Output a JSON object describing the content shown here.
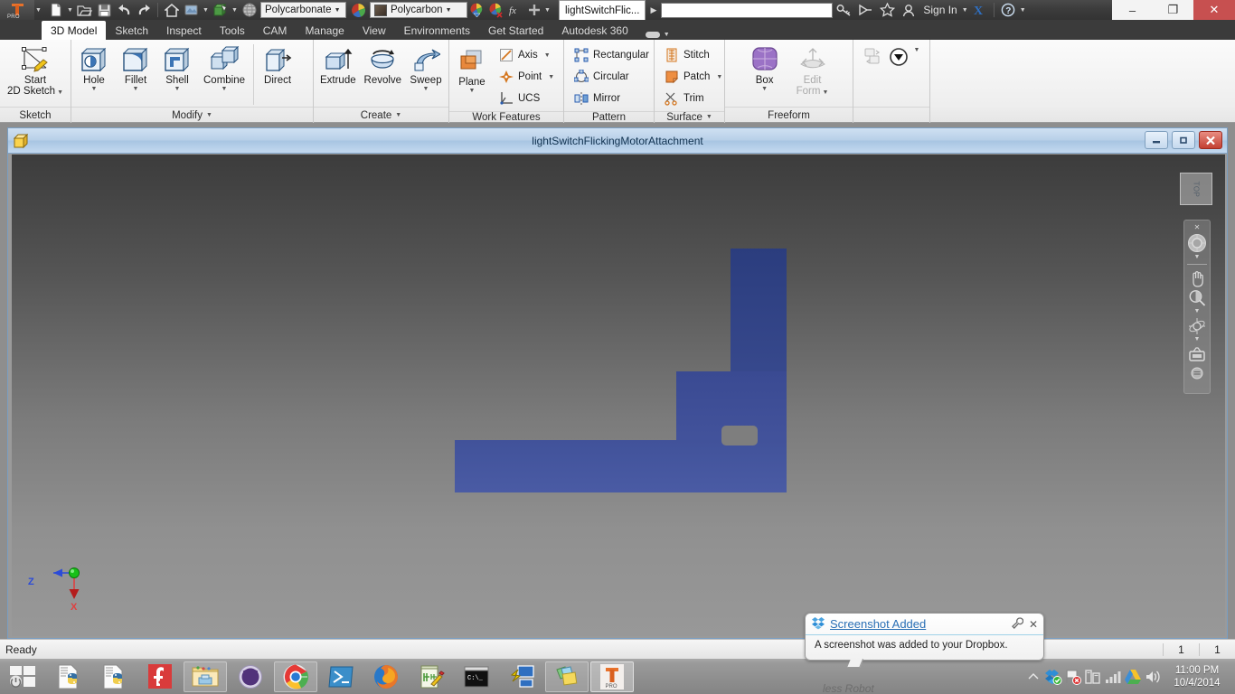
{
  "titlebar": {
    "app_logo": "inventor-logo",
    "app_logo_text": "PRO",
    "quick_access": [
      {
        "name": "new-document",
        "icon": "new-file-icon"
      },
      {
        "name": "open-document",
        "icon": "open-folder-icon"
      },
      {
        "name": "save-document",
        "icon": "save-disk-icon"
      },
      {
        "name": "undo",
        "icon": "undo-arrow-icon"
      },
      {
        "name": "redo",
        "icon": "redo-arrow-icon"
      },
      {
        "name": "home-view",
        "icon": "home-icon"
      },
      {
        "name": "appearance",
        "icon": "appearance-icon"
      },
      {
        "name": "material-swatch",
        "icon": "material-box-icon"
      },
      {
        "name": "render-globe",
        "icon": "globe-icon"
      }
    ],
    "material_combo": "Polycarbonate",
    "appearance_combo": "Polycarbon",
    "function_icon": "fx-icon",
    "document_tab": "lightSwitchFlic...",
    "search_placeholder": "",
    "search_value": "",
    "search_icon": "key-icon",
    "help_icons": [
      "satellite-icon",
      "star-icon"
    ],
    "sign_in": "Sign In",
    "exchange_icon": "X-exchange-icon",
    "help_icon": "question-help-icon",
    "window_controls": {
      "minimize": "–",
      "restore": "❐",
      "close": "✕"
    }
  },
  "ribbon_tabs": [
    {
      "label": "3D Model",
      "active": true
    },
    {
      "label": "Sketch",
      "active": false
    },
    {
      "label": "Inspect",
      "active": false
    },
    {
      "label": "Tools",
      "active": false
    },
    {
      "label": "CAM",
      "active": false
    },
    {
      "label": "Manage",
      "active": false
    },
    {
      "label": "View",
      "active": false
    },
    {
      "label": "Environments",
      "active": false
    },
    {
      "label": "Get Started",
      "active": false
    },
    {
      "label": "Autodesk 360",
      "active": false
    }
  ],
  "ribbon_panels": [
    {
      "title": "Sketch",
      "has_title_caret": false,
      "buttons": [
        {
          "label": "Start\n2D Sketch",
          "icon": "sketch-pencil-icon",
          "caret": true,
          "disabled": false
        }
      ]
    },
    {
      "title": "Modify",
      "has_title_caret": true,
      "buttons": [
        {
          "label": "Hole",
          "icon": "hole-cube-icon",
          "caret": true,
          "disabled": false
        },
        {
          "label": "Fillet",
          "icon": "fillet-cube-icon",
          "caret": true,
          "disabled": false
        },
        {
          "label": "Shell",
          "icon": "shell-cube-icon",
          "caret": true,
          "disabled": false
        },
        {
          "label": "Combine",
          "icon": "combine-cubes-icon",
          "caret": true,
          "disabled": false
        },
        {
          "label": "Direct",
          "icon": "direct-edit-icon",
          "caret": false,
          "disabled": false
        }
      ]
    },
    {
      "title": "Create",
      "has_title_caret": true,
      "buttons": [
        {
          "label": "Extrude",
          "icon": "extrude-icon",
          "caret": false,
          "disabled": false
        },
        {
          "label": "Revolve",
          "icon": "revolve-icon",
          "caret": false,
          "disabled": false
        },
        {
          "label": "Sweep",
          "icon": "sweep-icon",
          "caret": true,
          "disabled": false
        }
      ]
    },
    {
      "title": "Work Features",
      "has_title_caret": false,
      "buttons": [
        {
          "label": "Plane",
          "icon": "work-plane-icon",
          "caret": true,
          "disabled": false
        }
      ],
      "small_buttons": [
        {
          "label": "Axis",
          "icon": "work-axis-icon",
          "caret": true
        },
        {
          "label": "Point",
          "icon": "work-point-icon",
          "caret": true
        },
        {
          "label": "UCS",
          "icon": "ucs-icon",
          "caret": false
        }
      ]
    },
    {
      "title": "Pattern",
      "has_title_caret": false,
      "small_buttons": [
        {
          "label": "Rectangular",
          "icon": "rectangular-pattern-icon",
          "caret": false
        },
        {
          "label": "Circular",
          "icon": "circular-pattern-icon",
          "caret": false
        },
        {
          "label": "Mirror",
          "icon": "mirror-icon",
          "caret": false
        }
      ]
    },
    {
      "title": "Surface",
      "has_title_caret": true,
      "small_buttons": [
        {
          "label": "Stitch",
          "icon": "stitch-icon",
          "caret": false
        },
        {
          "label": "Patch",
          "icon": "patch-icon",
          "caret": true
        },
        {
          "label": "Trim",
          "icon": "trim-scissors-icon",
          "caret": false
        }
      ]
    },
    {
      "title": "Freeform",
      "has_title_caret": false,
      "buttons": [
        {
          "label": "Box",
          "icon": "freeform-box-icon",
          "caret": true,
          "disabled": false
        },
        {
          "label": "Edit\nForm",
          "icon": "edit-form-icon",
          "caret": true,
          "disabled": true
        }
      ]
    },
    {
      "title": "",
      "has_title_caret": false,
      "buttons": [
        {
          "label": "",
          "icon": "convert-icon",
          "caret": false,
          "disabled": true
        },
        {
          "label": "",
          "icon": "plastic-part-icon",
          "caret": true,
          "disabled": false
        }
      ]
    }
  ],
  "document_window": {
    "icon": "yellow-cube-icon",
    "title": "lightSwitchFlickingMotorAttachment",
    "controls": {
      "minimize": "—",
      "restore": "□",
      "close": "✕"
    }
  },
  "viewport": {
    "view_cube_label": "TOP",
    "nav_bar": [
      {
        "name": "steering-wheel-icon"
      },
      {
        "name": "pan-hand-icon"
      },
      {
        "name": "zoom-magnifier-icon"
      },
      {
        "name": "orbit-icon"
      },
      {
        "name": "look-at-camera-icon"
      }
    ],
    "nav_close_icon": "close-icon",
    "axis_indicator": {
      "z_label": "Z",
      "x_label": "X"
    },
    "model": {
      "name": "l-bracket-part",
      "body_color": "#41529a",
      "vertical_arm_color": "#2b3d7e",
      "slot_color": "#7e7e7e"
    }
  },
  "notification": {
    "icon": "dropbox-icon",
    "title": "Screenshot Added",
    "body": "A screenshot was added to your Dropbox.",
    "settings_icon": "wrench-icon",
    "close_icon": "close-x-icon"
  },
  "statusbar": {
    "message": "Ready",
    "cells": [
      "1",
      "1"
    ]
  },
  "taskbar": {
    "start_icon": "windows-start-icon",
    "items": [
      {
        "name": "python-file-1",
        "icon": "python-file-icon",
        "state": "normal"
      },
      {
        "name": "python-file-2",
        "icon": "python-file-icon",
        "state": "normal"
      },
      {
        "name": "fritzing",
        "icon": "fritzing-f-icon",
        "state": "normal"
      },
      {
        "name": "file-explorer",
        "icon": "explorer-folder-icon",
        "state": "pinned"
      },
      {
        "name": "octocat-app",
        "icon": "octocat-icon",
        "state": "normal"
      },
      {
        "name": "google-chrome",
        "icon": "chrome-icon",
        "state": "pinned"
      },
      {
        "name": "powershell",
        "icon": "powershell-icon",
        "state": "normal"
      },
      {
        "name": "firefox",
        "icon": "firefox-icon",
        "state": "normal"
      },
      {
        "name": "notepad-plus-plus",
        "icon": "notepadpp-icon",
        "state": "normal"
      },
      {
        "name": "command-prompt",
        "icon": "cmd-prompt-icon",
        "state": "normal"
      },
      {
        "name": "remote-desktop",
        "icon": "remote-desktop-icon",
        "state": "normal"
      },
      {
        "name": "sticky-pages",
        "icon": "colored-pages-icon",
        "state": "pinned"
      },
      {
        "name": "inventor-pro",
        "icon": "inventor-pro-icon",
        "state": "active"
      }
    ],
    "tray": [
      {
        "name": "show-hidden-icons",
        "icon": "up-chevron-icon"
      },
      {
        "name": "dropbox-tray",
        "icon": "dropbox-tray-icon"
      },
      {
        "name": "action-center",
        "icon": "flag-alert-icon"
      },
      {
        "name": "network-devices",
        "icon": "devices-icon"
      },
      {
        "name": "network-signal",
        "icon": "signal-bars-icon"
      },
      {
        "name": "google-drive",
        "icon": "google-drive-icon"
      },
      {
        "name": "volume",
        "icon": "speaker-icon"
      }
    ],
    "clock_time": "11:00 PM",
    "clock_date": "10/4/2014",
    "desktop_ghost_text": "less Robot"
  }
}
